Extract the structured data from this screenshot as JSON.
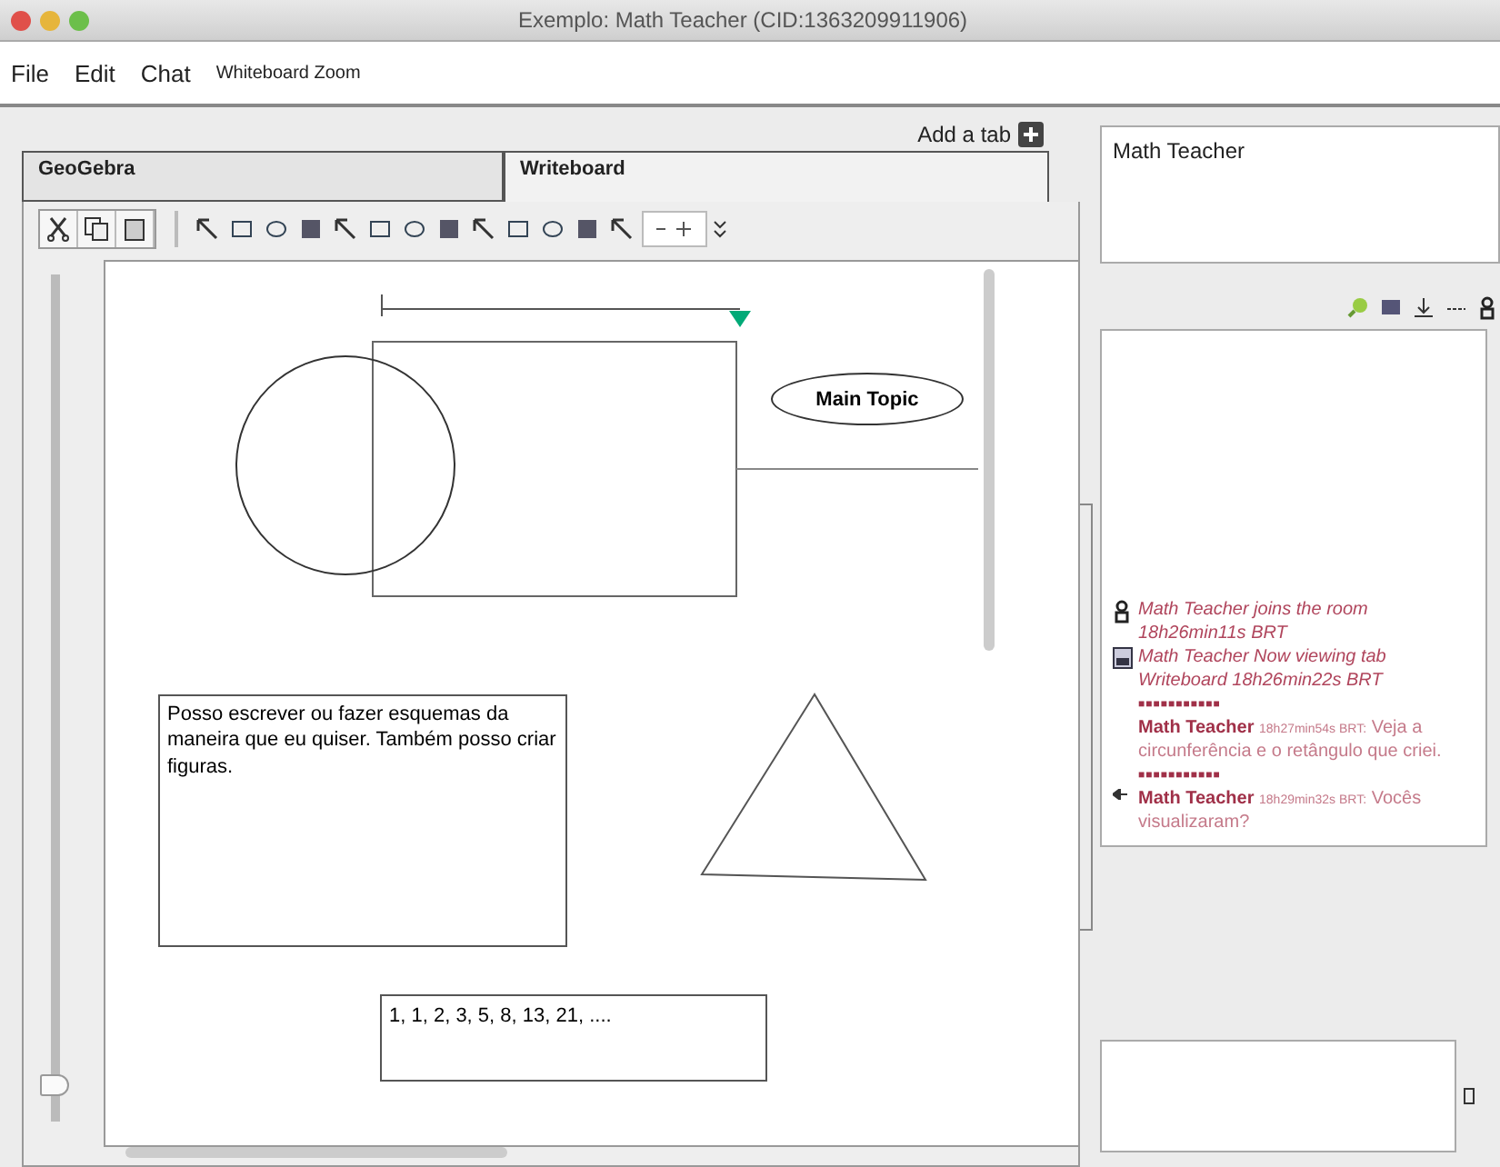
{
  "window": {
    "title": "Exemplo: Math Teacher (CID:1363209911906)"
  },
  "menu": [
    {
      "label": "File",
      "small": false
    },
    {
      "label": "Edit",
      "small": false
    },
    {
      "label": "Chat",
      "small": false
    },
    {
      "label": "Whiteboard Zoom",
      "small": true
    }
  ],
  "add_tab": {
    "label": "Add a tab"
  },
  "tabs": [
    {
      "label": "GeoGebra",
      "selected": false
    },
    {
      "label": "Writeboard",
      "selected": true
    }
  ],
  "zoom_slider": {
    "level": 0.03
  },
  "whiteboard": {
    "topic": "Main Topic",
    "note": "Posso escrever ou fazer esquemas da maneira que eu quiser. Também posso criar figuras.",
    "sequence": "1, 1, 2, 3, 5, 8, 13, 21, ...."
  },
  "users": [
    {
      "name": "Math Teacher"
    }
  ],
  "chat": [
    {
      "kind": "join",
      "text": "Math Teacher joins the room 18h26min11s BRT"
    },
    {
      "kind": "view",
      "text": "Math Teacher Now viewing tab Writeboard 18h26min22s BRT"
    },
    {
      "kind": "separator",
      "text": "■■■■■■■■■■■"
    },
    {
      "kind": "message",
      "author": "Math Teacher",
      "time": "18h27min54s BRT:",
      "text": "Veja a circunferência e o retângulo que criei.",
      "pointer": false
    },
    {
      "kind": "separator",
      "text": "■■■■■■■■■■■"
    },
    {
      "kind": "message",
      "author": "Math Teacher",
      "time": "18h29min32s BRT:",
      "text": "Vocês visualizaram?",
      "pointer": true
    }
  ]
}
